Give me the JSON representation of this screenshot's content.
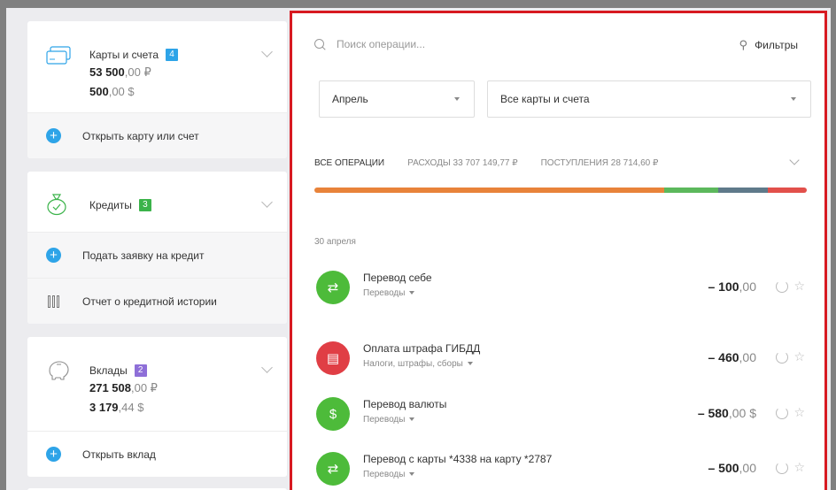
{
  "sidebar": {
    "cards": {
      "label": "Карты и счета",
      "count": "4",
      "badge_color": "#2ea4e8",
      "amounts": [
        {
          "int": "53 500",
          "frac": ",00 ₽"
        },
        {
          "int": "500",
          "frac": ",00 $"
        }
      ],
      "action": "Открыть карту или счет"
    },
    "credits": {
      "label": "Кредиты",
      "count": "3",
      "badge_color": "#3bb34a",
      "action": "Подать заявку на кредит",
      "report": "Отчет о кредитной истории"
    },
    "deposits": {
      "label": "Вклады",
      "count": "2",
      "badge_color": "#8e6fd8",
      "amounts": [
        {
          "int": "271 508",
          "frac": ",00 ₽"
        },
        {
          "int": "3 179",
          "frac": ",44 $"
        }
      ],
      "action": "Открыть вклад"
    }
  },
  "main": {
    "search_placeholder": "Поиск операции...",
    "filters_label": "Фильтры",
    "month_select": "Апрель",
    "account_select": "Все карты и счета",
    "tabs": {
      "all": "ВСЕ ОПЕРАЦИИ",
      "expenses": "РАСХОДЫ 33 707 149,77 ₽",
      "income": "ПОСТУПЛЕНИЯ 28 714,60 ₽"
    },
    "bar_segments": [
      {
        "share": 0.71,
        "color": "#e8833a"
      },
      {
        "share": 0.11,
        "color": "#5cb85c"
      },
      {
        "share": 0.1,
        "color": "#5f7a8a"
      },
      {
        "share": 0.08,
        "color": "#e2504b"
      }
    ],
    "date": "30 апреля",
    "operations": [
      {
        "name": "Перевод себе",
        "category": "Переводы",
        "int": "– 100",
        "frac": ",00",
        "icon": "transfer-icon",
        "color": "#4dbb3a"
      },
      {
        "name": "Оплата штрафа ГИБДД",
        "category": "Налоги, штрафы, сборы",
        "int": "– 460",
        "frac": ",00",
        "icon": "receipt-icon",
        "color": "#e03e45"
      },
      {
        "name": "Перевод валюты",
        "category": "Переводы",
        "int": "– 580",
        "frac": ",00 $",
        "icon": "currency-icon",
        "color": "#4dbb3a"
      },
      {
        "name": "Перевод с карты *4338 на карту *2787",
        "category": "Переводы",
        "int": "– 500",
        "frac": ",00",
        "icon": "transfer-icon",
        "color": "#4dbb3a"
      }
    ]
  }
}
